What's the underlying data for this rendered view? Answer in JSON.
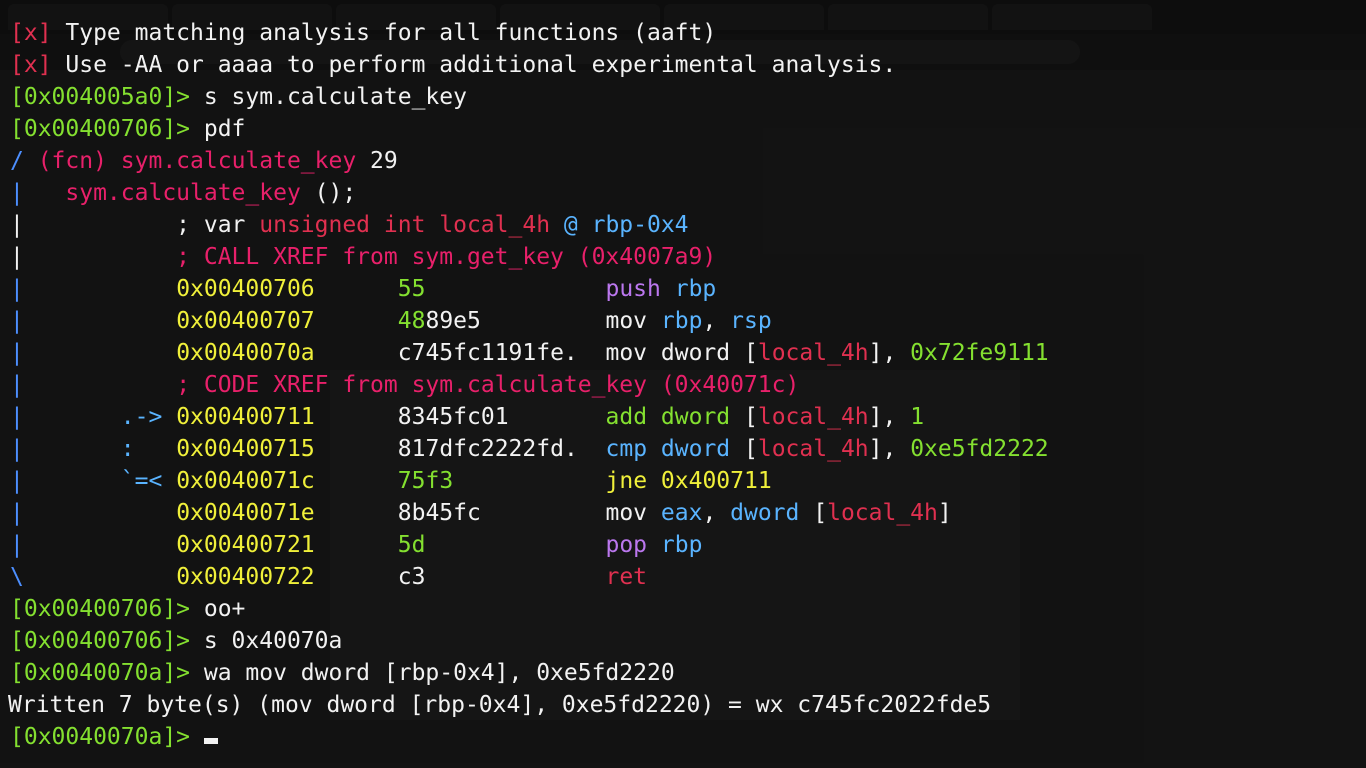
{
  "colors": {
    "error_tag": "#e03050",
    "prompt": "#84e030",
    "address": "#f0f03a",
    "keyword": "#e8206a",
    "register": "#5ab4ff",
    "stack_op": "#bb77ee"
  },
  "terminal": {
    "tag_x": "[x]",
    "line1": " Type matching analysis for all functions (aaft)",
    "line2": " Use -AA or aaaa to perform additional experimental analysis.",
    "prompt1": "[0x004005a0]>",
    "cmd1": " s sym.calculate_key",
    "prompt2": "[0x00400706]>",
    "cmd2": " pdf",
    "fcn_bar": "/ ",
    "fcn_label": "(fcn) sym.calculate_key",
    "fcn_size": " 29",
    "sig_bar": "|   ",
    "sig_name": "sym.calculate_key",
    "sig_rest": " ();",
    "var_pre": "|           ; var ",
    "var_type": "unsigned int local_4h",
    "var_at": " @ ",
    "var_loc": "rbp-0x4",
    "xref1_bar": "|           ",
    "xref1": "; CALL XREF from sym.get_key (0x4007a9)",
    "xref2": "; CODE XREF from sym.calculate_key (0x40071c)",
    "asm": {
      "r1": {
        "bar": "|           ",
        "addr": "0x00400706",
        "b1": "      ",
        "bytes_a": "",
        "bytes_b": "55",
        "gap": "             ",
        "mn": "push",
        "ops": [
          " ",
          "rbp"
        ]
      },
      "r2": {
        "addr": "0x00400707",
        "bytes_a": "48",
        "bytes_b": "89e5",
        "mn": "mov",
        "op1": "rbp",
        "op2": "rsp"
      },
      "r3": {
        "addr": "0x0040070a",
        "bytes": "c745fc1191fe.",
        "mn": "mov",
        "op_a": "dword",
        "op_b": "local_4h",
        "op_c": "0x72fe9111"
      },
      "r4": {
        "arrow": ".->",
        "addr": "0x00400711",
        "bytes": "8345fc01",
        "mn": "add",
        "op_a": "dword",
        "op_b": "local_4h",
        "op_c": "1"
      },
      "r5": {
        "arrow": ":",
        "addr": "0x00400715",
        "bytes": "817dfc2222fd.",
        "mn": "cmp",
        "op_a": "dword",
        "op_b": "local_4h",
        "op_c": "0xe5fd2222"
      },
      "r6": {
        "arrow": "`=<",
        "addr": "0x0040071c",
        "bytes": "75f3",
        "mn": "jne",
        "op": "0x400711"
      },
      "r7": {
        "addr": "0x0040071e",
        "bytes": "8b45fc",
        "mn": "mov",
        "op1": "eax",
        "op2": "dword",
        "op3": "local_4h"
      },
      "r8": {
        "addr": "0x00400721",
        "bytes": "5d",
        "mn": "pop",
        "op": "rbp"
      },
      "r9": {
        "addr": "0x00400722",
        "bytes": "c3",
        "mn": "ret"
      }
    },
    "prompt3": "[0x00400706]>",
    "cmd3": " oo+",
    "prompt4": "[0x00400706]>",
    "cmd4": " s 0x40070a",
    "prompt5": "[0x0040070a]>",
    "cmd5": " wa mov dword [rbp-0x4], 0xe5fd2220",
    "written": "Written 7 byte(s) (mov dword [rbp-0x4], 0xe5fd2220) = wx c745fc2022fde5",
    "prompt6": "[0x0040070a]>"
  }
}
